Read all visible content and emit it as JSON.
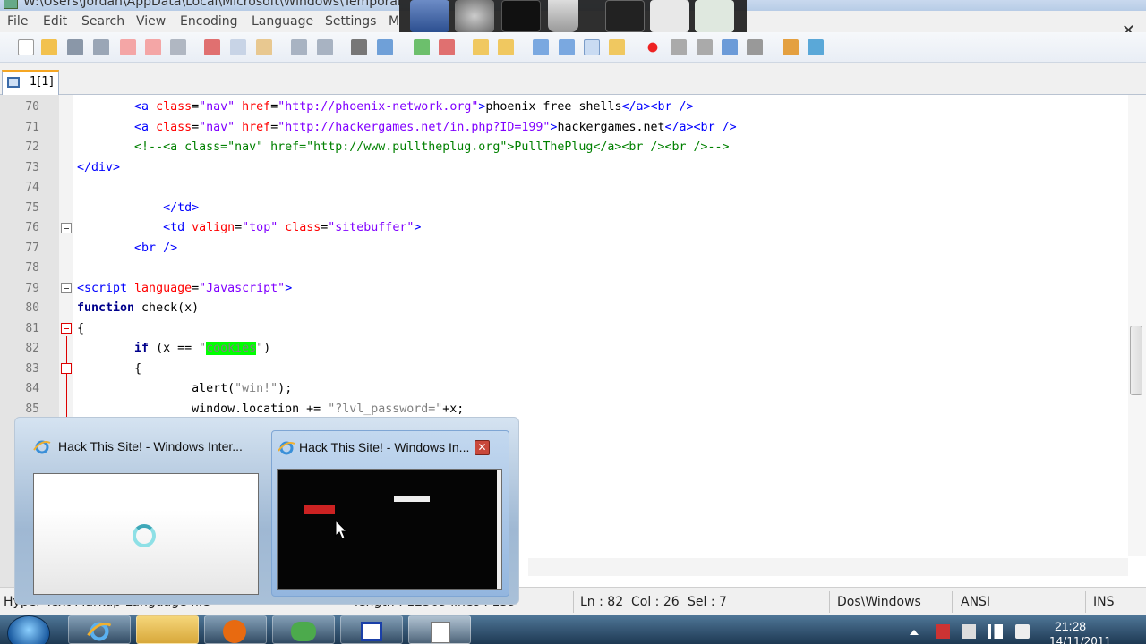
{
  "window": {
    "title": "W:\\Users\\Jordan\\AppData\\Local\\Microsoft\\Windows\\Temporar",
    "close_glyph": "✕"
  },
  "menu": [
    "File",
    "Edit",
    "Search",
    "View",
    "Encoding",
    "Language",
    "Settings",
    "M"
  ],
  "tab": {
    "label": "1[1]"
  },
  "code_lines": [
    {
      "n": "70",
      "parts": [
        [
          "",
          "        "
        ],
        [
          "tag",
          "<a "
        ],
        [
          "attr",
          "class"
        ],
        [
          "txt",
          "="
        ],
        [
          "val",
          "\"nav\""
        ],
        [
          "attr",
          " href"
        ],
        [
          "txt",
          "="
        ],
        [
          "val",
          "\"http://phoenix-network.org\""
        ],
        [
          "tag",
          ">"
        ],
        [
          "txt",
          "phoenix free shells"
        ],
        [
          "tag",
          "</a><br />"
        ]
      ]
    },
    {
      "n": "71",
      "parts": [
        [
          "",
          "        "
        ],
        [
          "tag",
          "<a "
        ],
        [
          "attr",
          "class"
        ],
        [
          "txt",
          "="
        ],
        [
          "val",
          "\"nav\""
        ],
        [
          "attr",
          " href"
        ],
        [
          "txt",
          "="
        ],
        [
          "val",
          "\"http://hackergames.net/in.php?ID=199\""
        ],
        [
          "tag",
          ">"
        ],
        [
          "txt",
          "hackergames.net"
        ],
        [
          "tag",
          "</a><br />"
        ]
      ]
    },
    {
      "n": "72",
      "parts": [
        [
          "",
          "        "
        ],
        [
          "cmt",
          "<!--<a class=\"nav\" href=\"http://www.pulltheplug.org\">PullThePlug</a><br /><br />-->"
        ]
      ]
    },
    {
      "n": "73",
      "parts": [
        [
          "tag",
          "</div>"
        ]
      ]
    },
    {
      "n": "74",
      "parts": [
        [
          "",
          ""
        ]
      ]
    },
    {
      "n": "75",
      "parts": [
        [
          "",
          "            "
        ],
        [
          "tag",
          "</td>"
        ]
      ]
    },
    {
      "n": "76",
      "parts": [
        [
          "",
          "            "
        ],
        [
          "tag",
          "<td "
        ],
        [
          "attr",
          "valign"
        ],
        [
          "txt",
          "="
        ],
        [
          "val",
          "\"top\""
        ],
        [
          "attr",
          " class"
        ],
        [
          "txt",
          "="
        ],
        [
          "val",
          "\"sitebuffer\""
        ],
        [
          "tag",
          ">"
        ]
      ]
    },
    {
      "n": "77",
      "parts": [
        [
          "",
          "        "
        ],
        [
          "tag",
          "<br />"
        ]
      ]
    },
    {
      "n": "78",
      "parts": [
        [
          "",
          ""
        ]
      ]
    },
    {
      "n": "79",
      "parts": [
        [
          "tag",
          "<script "
        ],
        [
          "attr",
          "language"
        ],
        [
          "txt",
          "="
        ],
        [
          "val",
          "\"Javascript\""
        ],
        [
          "tag",
          ">"
        ]
      ]
    },
    {
      "n": "80",
      "parts": [
        [
          "kw",
          "function"
        ],
        [
          "txt",
          " check(x)"
        ]
      ]
    },
    {
      "n": "81",
      "parts": [
        [
          "txt",
          "{"
        ]
      ]
    },
    {
      "n": "82",
      "parts": [
        [
          "",
          "        "
        ],
        [
          "kw",
          "if"
        ],
        [
          "txt",
          " (x == "
        ],
        [
          "str",
          "\""
        ],
        [
          "hl",
          "cookies"
        ],
        [
          "str",
          "\""
        ],
        [
          "txt",
          ")"
        ]
      ]
    },
    {
      "n": "83",
      "parts": [
        [
          "",
          "        "
        ],
        [
          "txt",
          "{"
        ]
      ]
    },
    {
      "n": "84",
      "parts": [
        [
          "",
          "                "
        ],
        [
          "txt",
          "alert("
        ],
        [
          "str",
          "\"win!\""
        ],
        [
          "txt",
          ");"
        ]
      ]
    },
    {
      "n": "85",
      "parts": [
        [
          "",
          "                "
        ],
        [
          "txt",
          "window.location += "
        ],
        [
          "str",
          "\"?lvl_password=\""
        ],
        [
          "txt",
          "+x;"
        ]
      ]
    }
  ],
  "status": {
    "lang": "Hyper Text Markup Language file",
    "length": "length : 12565    lines : 159",
    "ln": "Ln : 82",
    "col": "Col : 26",
    "sel": "Sel : 7",
    "eol": "Dos\\Windows",
    "encoding": "ANSI",
    "mode": "INS"
  },
  "thumbnails": [
    {
      "title": "Hack This Site! - Windows Inter..."
    },
    {
      "title": "Hack This Site! - Windows In..."
    }
  ],
  "clock": {
    "time": "21:28",
    "date": "14/11/2011"
  }
}
